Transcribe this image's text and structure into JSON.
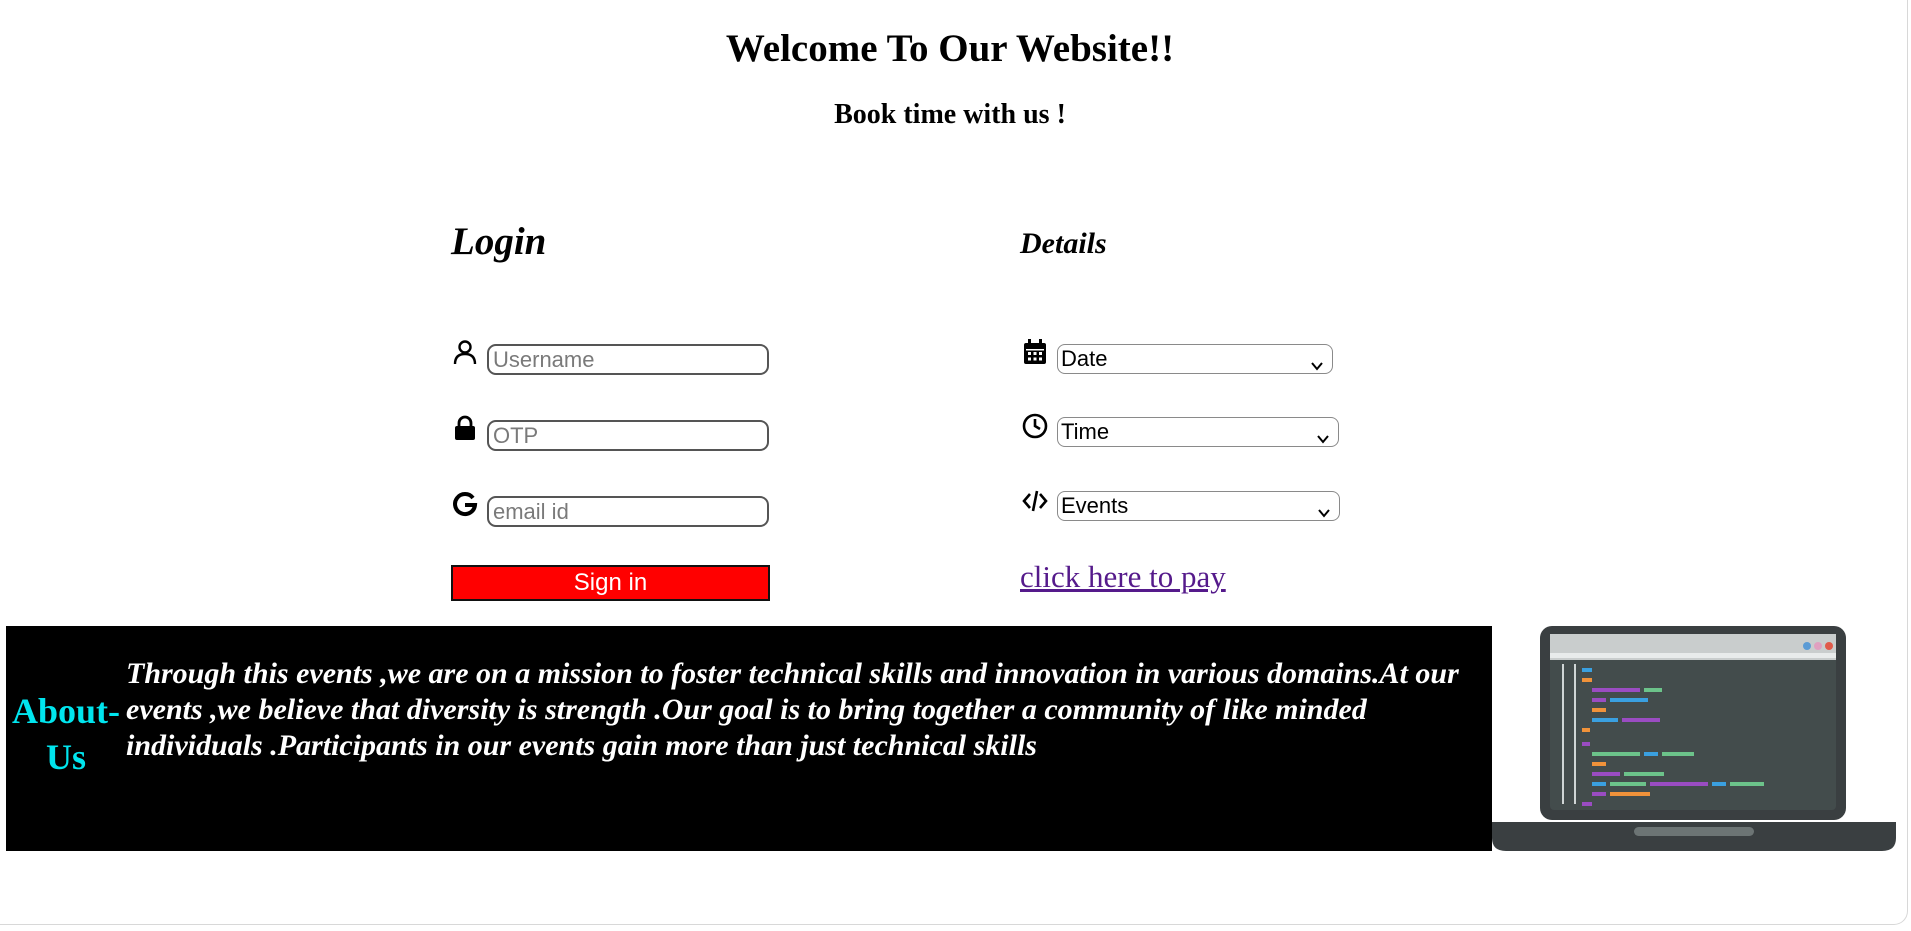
{
  "header": {
    "title": "Welcome To Our Website!!",
    "subtitle": "Book time with us !"
  },
  "login": {
    "heading": "Login",
    "username_placeholder": "Username",
    "otp_placeholder": "OTP",
    "email_placeholder": "email id",
    "signin_label": "Sign in",
    "icons": [
      "user-icon",
      "lock-icon",
      "google-icon"
    ]
  },
  "details": {
    "heading": "Details",
    "date_selected": "Date",
    "time_selected": "Time",
    "events_selected": "Events",
    "pay_link": "click here to pay",
    "icons": [
      "calendar-icon",
      "clock-icon",
      "code-icon"
    ]
  },
  "about": {
    "heading": "About-Us",
    "text": "Through this events ,we are on a mission to foster technical skills and innovation in various domains.At our events ,we believe that diversity is strength .Our goal is to bring together a community of like minded individuals .Participants in our events gain more than just technical skills"
  },
  "colors": {
    "signin_bg": "#ff0000",
    "about_bg": "#000000",
    "about_heading": "#00e5ee",
    "link": "#551a8b"
  }
}
